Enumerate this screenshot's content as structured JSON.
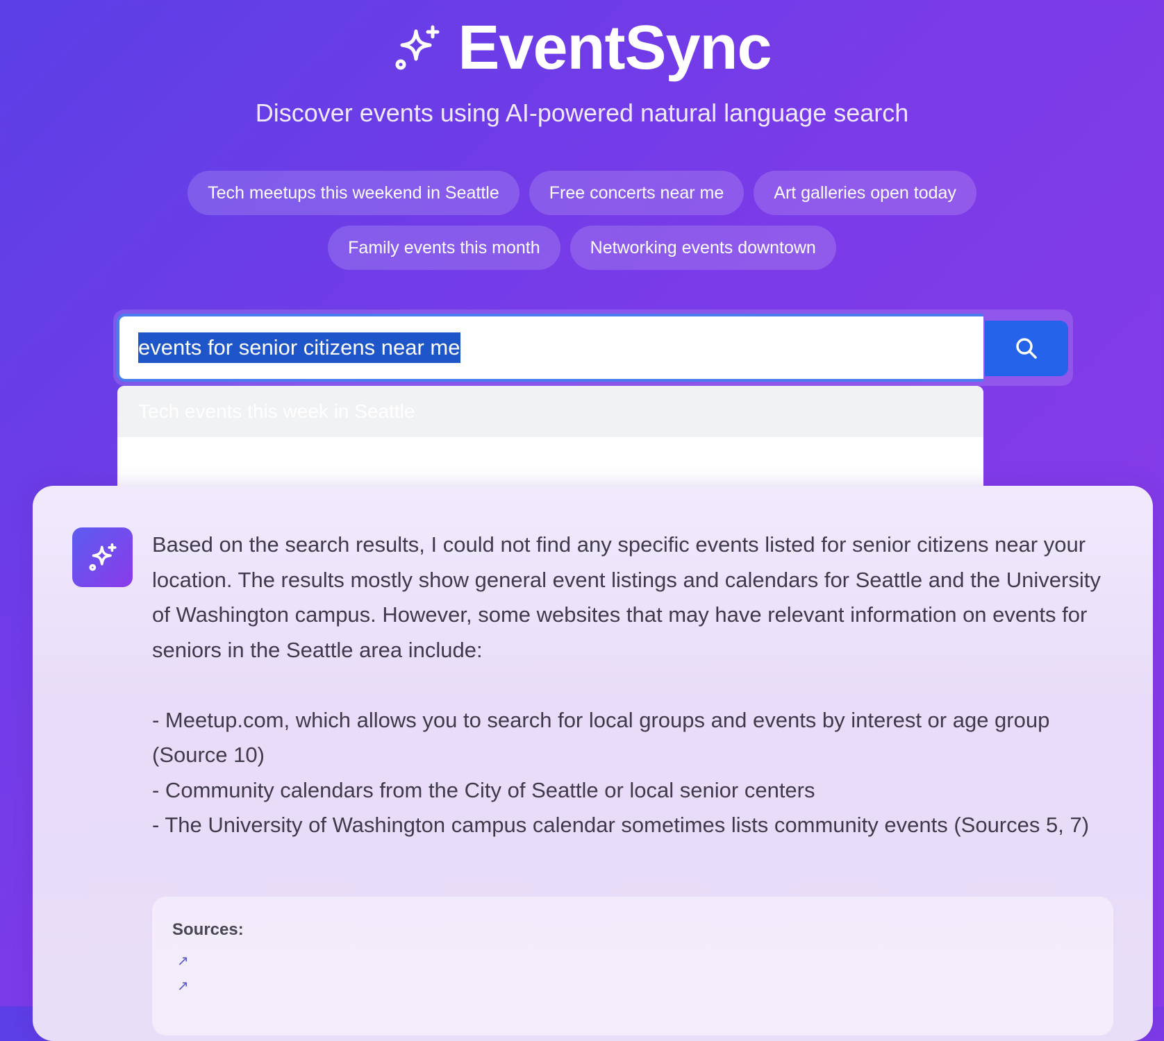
{
  "brand": {
    "name": "EventSync",
    "icon": "sparkles-icon"
  },
  "subtitle": "Discover events using AI-powered natural language search",
  "suggestions": [
    "Tech meetups this weekend in Seattle",
    "Free concerts near me",
    "Art galleries open today",
    "Family events this month",
    "Networking events downtown"
  ],
  "search": {
    "value": "events for senior citizens near me",
    "button_icon": "search-icon"
  },
  "dropdown": {
    "items": [
      "Tech events this week in Seattle"
    ]
  },
  "answer": {
    "paragraphs": [
      "Based on the search results, I could not find any specific events listed for senior citizens near your location. The results mostly show general event listings and calendars for Seattle and the University of Washington campus. However, some websites that may have relevant information on events for seniors in the Seattle area include:",
      "- Meetup.com, which allows you to search for local groups and events by interest or age group (Source 10)",
      "- Community calendars from the City of Seattle or local senior centers",
      "- The University of Washington campus calendar sometimes lists community events (Sources 5, 7)"
    ]
  },
  "sources": {
    "title": "Sources:",
    "links": [
      "↗",
      "↗"
    ]
  },
  "colors": {
    "accent": "#2563eb",
    "gradient_start": "#5b3fe6",
    "gradient_end": "#8b3be9"
  }
}
